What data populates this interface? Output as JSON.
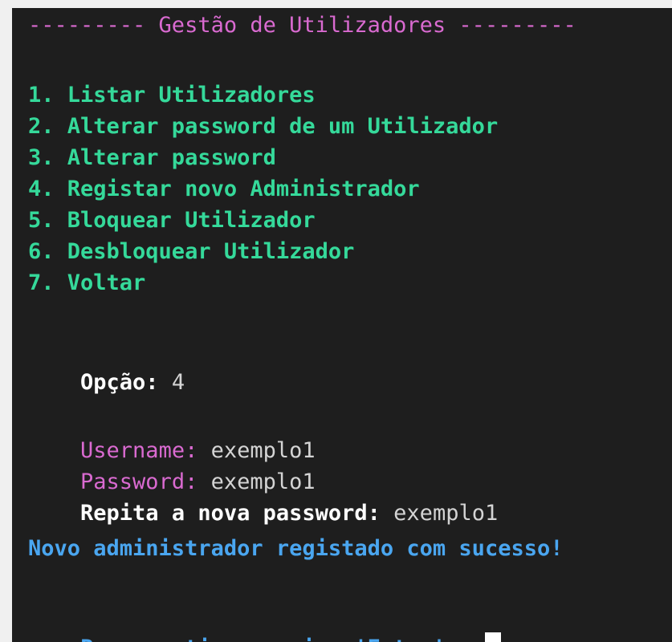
{
  "header": {
    "title_line": "--------- Gestão de Utilizadores ---------"
  },
  "menu": {
    "items": [
      "1. Listar Utilizadores",
      "2. Alterar password de um Utilizador",
      "3. Alterar password",
      "4. Registar novo Administrador",
      "5. Bloquear Utilizador",
      "6. Desbloquear Utilizador",
      "7. Voltar"
    ]
  },
  "prompt": {
    "label": "Opção:",
    "value": "4"
  },
  "form": {
    "username_label": "Username:",
    "username_value": "exemplo1",
    "password_label": "Password:",
    "password_value": "exemplo1",
    "repeat_label": "Repita a nova password:",
    "repeat_value": "exemplo1"
  },
  "messages": {
    "success": "Novo administrador registado com sucesso!",
    "continue": "Para continuar prima 'Enter'..."
  },
  "colors": {
    "background": "#1e1e1e",
    "header": "#d96ad0",
    "menu": "#35d99a",
    "info": "#4aa6f0",
    "text": "#d4d4d4"
  }
}
